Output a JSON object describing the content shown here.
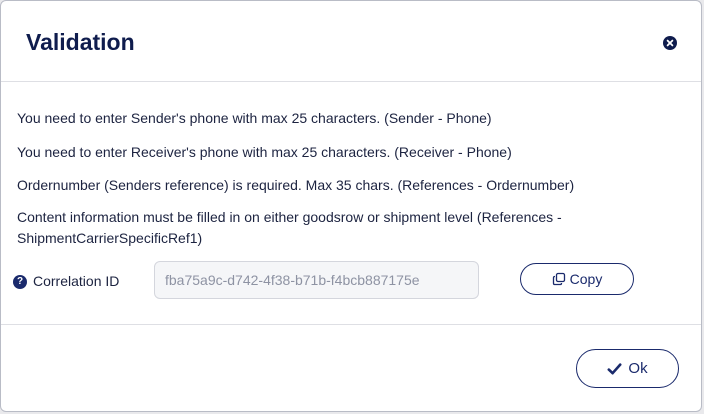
{
  "dialog": {
    "title": "Validation",
    "close_icon": "close-icon",
    "messages": [
      "You need to enter Sender's phone with max 25 characters. (Sender - Phone)",
      "You need to enter Receiver's phone with max 25 characters. (Receiver - Phone)",
      "Ordernumber (Senders reference) is required. Max 35 chars. (References - Ordernumber)",
      "Content information must be filled in on either goodsrow or shipment level (References - ShipmentCarrierSpecificRef1)"
    ],
    "correlation": {
      "help_icon": "question-icon",
      "help_glyph": "?",
      "label": "Correlation ID",
      "value": "fba75a9c-d742-4f38-b71b-f4bcb887175e"
    },
    "copy_button": {
      "icon": "copy-icon",
      "label": "Copy"
    },
    "ok_button": {
      "icon": "checkmark-icon",
      "label": "Ok"
    }
  },
  "colors": {
    "primary": "#1a2a6c",
    "title": "#0f1c4d",
    "text": "#1c2340",
    "input_bg": "#f5f6f8",
    "input_text": "#8e93a3",
    "divider": "#dedfe4"
  }
}
